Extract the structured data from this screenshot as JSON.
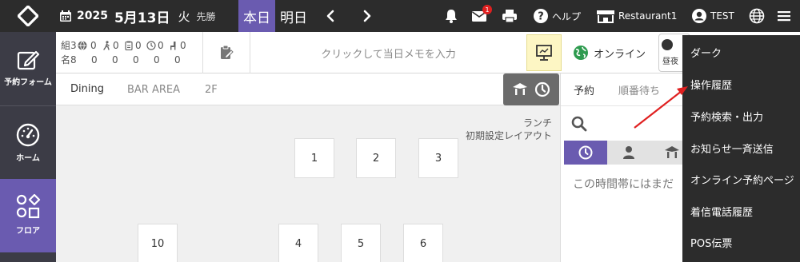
{
  "header": {
    "year": "2025",
    "month_day": "5月13日",
    "weekday": "火",
    "rokuyo": "先勝",
    "today_label": "本日",
    "tomorrow_label": "明日",
    "help_label": "ヘルプ",
    "restaurant_label": "Restaurant1",
    "user_label": "TEST",
    "mail_badge": "1"
  },
  "sidebar": {
    "items": [
      {
        "label": "予約フォーム",
        "icon": "edit-icon"
      },
      {
        "label": "ホーム",
        "icon": "gauge-icon"
      },
      {
        "label": "フロア",
        "icon": "shapes-icon"
      }
    ]
  },
  "counts": {
    "row1_prefix": "組",
    "row2_prefix": "名",
    "row1": [
      "3",
      "0",
      "0",
      "0",
      "0",
      "0"
    ],
    "row2": [
      "8",
      "0",
      "0",
      "0",
      "0",
      "0"
    ]
  },
  "memo_placeholder": "クリックして当日メモを入力",
  "online_label": "オンライン",
  "daynight_label": "昼夜",
  "floor_tabs": [
    "Dining",
    "BAR AREA",
    "2F"
  ],
  "layout_label_line1": "ランチ",
  "layout_label_line2": "初期設定レイアウト",
  "tables": [
    "1",
    "2",
    "3",
    "10",
    "4",
    "5",
    "6"
  ],
  "right_panel": {
    "tab1": "予約",
    "tab2": "順番待ち",
    "empty_message": "この時間帯にはまだ"
  },
  "menu": {
    "items": [
      "ダーク",
      "操作履歴",
      "予約検索・出力",
      "お知らせ一斉送信",
      "オンライン予約ページ",
      "着信電話履歴",
      "POS伝票"
    ]
  },
  "colors": {
    "accent": "#6a5bb0",
    "topbar": "#2c2c2c",
    "sidebar": "#3c3c46",
    "online_green": "#2e9b4f",
    "badge_red": "#e02020",
    "annotation_arrow": "#e02020"
  }
}
